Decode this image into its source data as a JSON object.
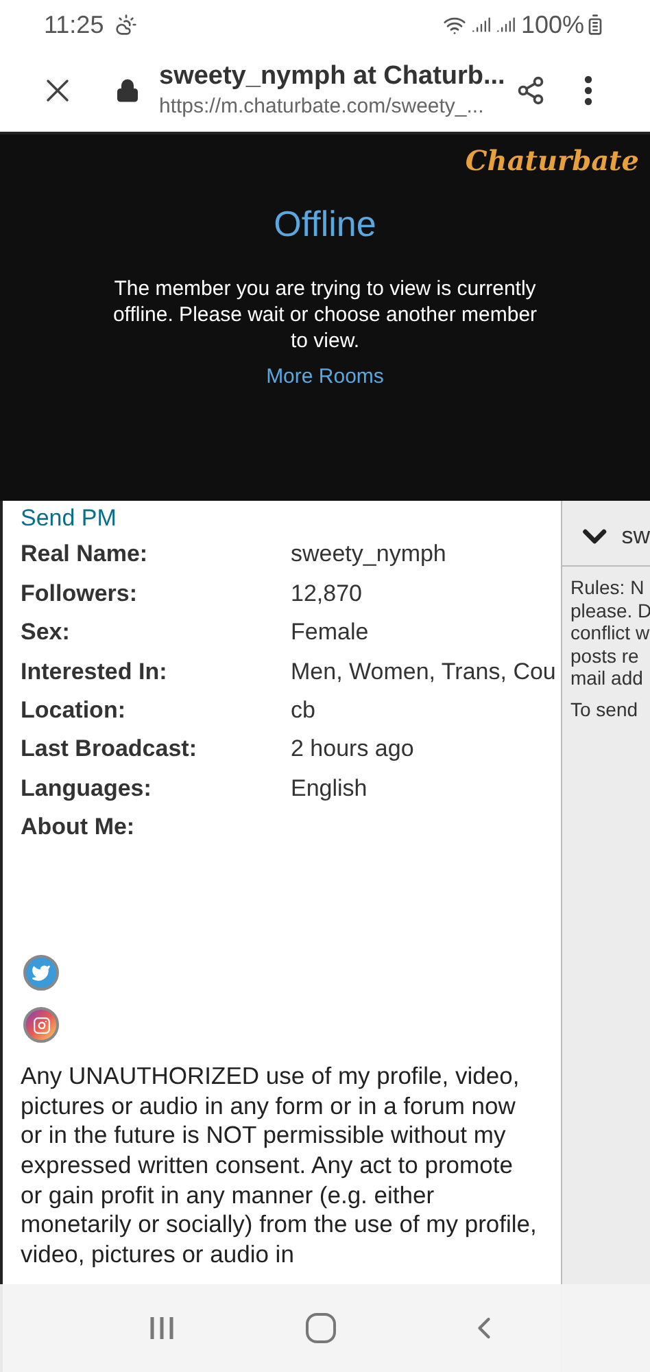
{
  "status_bar": {
    "time": "11:25",
    "battery": "100%"
  },
  "browser": {
    "title": "sweety_nymph at Chaturb...",
    "url": "https://m.chaturbate.com/sweety_..."
  },
  "banner": {
    "logo": "Chaturbate",
    "heading": "Offline",
    "message": "The member you are trying to view is currently offline. Please wait or choose another member to view.",
    "link": "More Rooms"
  },
  "profile": {
    "send_pm": "Send PM",
    "fields": [
      {
        "label": "Real Name:",
        "value": "sweety_nymph"
      },
      {
        "label": "Followers:",
        "value": "12,870"
      },
      {
        "label": "Sex:",
        "value": "Female"
      },
      {
        "label": "Interested In:",
        "value": "Men, Women, Trans, Cou"
      },
      {
        "label": "Location:",
        "value": "cb"
      },
      {
        "label": "Last Broadcast:",
        "value": "2 hours ago"
      },
      {
        "label": "Languages:",
        "value": "English"
      },
      {
        "label": "About Me:"
      }
    ],
    "social": [
      {
        "kind": "twitter"
      },
      {
        "kind": "instagram"
      }
    ],
    "notice": "Any UNAUTHORIZED use of my profile, video, pictures or audio in any form or in a forum now or in the future is NOT permissible without my expressed written consent. Any act to promote or gain profit in any manner (e.g. either monetarily or socially) from the use of my profile, video, pictures or audio in"
  },
  "side_panel": {
    "header": "sw",
    "rules_lines": [
      "Rules: N",
      "please. D",
      "conflict w",
      "posts re",
      "mail add"
    ],
    "send_line": "To send"
  }
}
